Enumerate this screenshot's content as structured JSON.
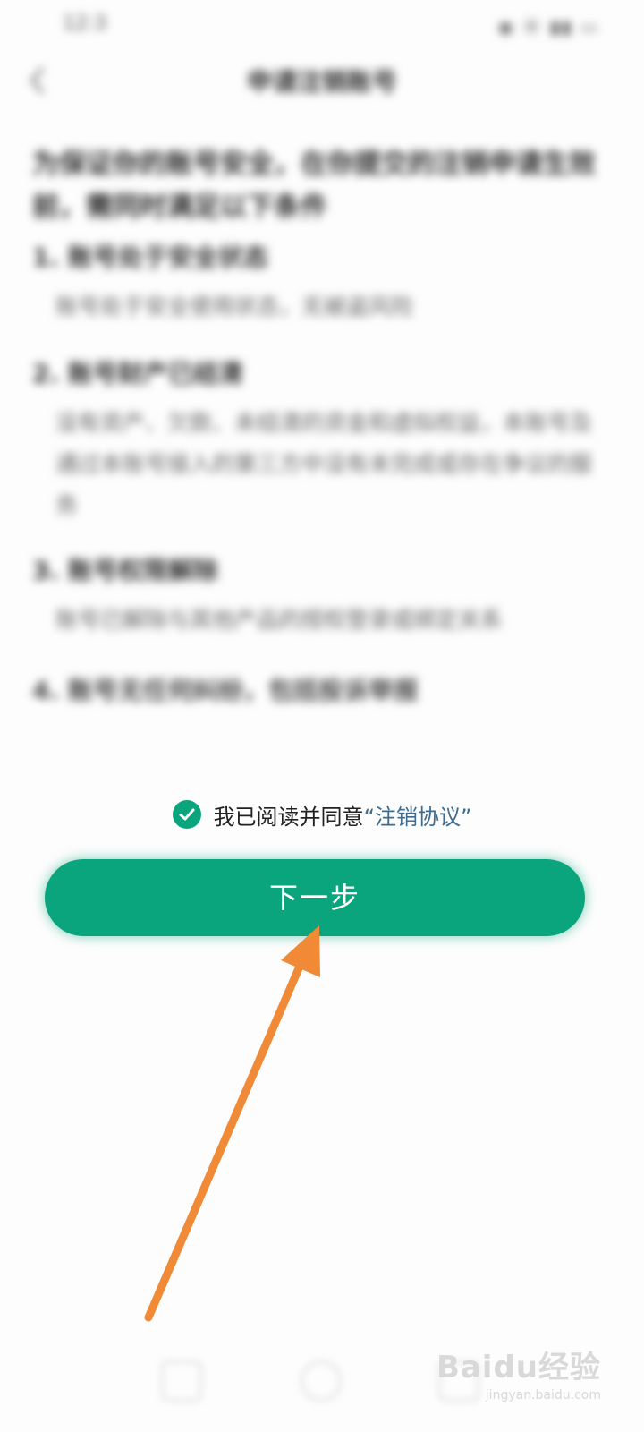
{
  "status_bar": {
    "time": "12:3",
    "icons": "◉ ⦿ ▮▮ ▭"
  },
  "nav": {
    "title": "申请注销账号"
  },
  "intro": "为保证你的账号安全，在你提交的注销申请生效前，需同时满足以下条件",
  "conditions": [
    {
      "title": "1. 账号处于安全状态",
      "desc": "账号处于安全使用状态，无被盗风险"
    },
    {
      "title": "2. 账号财产已结清",
      "desc": "没有资产、欠款、未结清的资金和虚拟权益，本账号及通过本账号接入的第三方中没有未完成或存在争议的服务"
    },
    {
      "title": "3. 账号权限解除",
      "desc": "账号已解除与其他产品的授权登录或绑定关系"
    },
    {
      "title": "4. 账号无任何纠纷，包括投诉举报",
      "desc": ""
    }
  ],
  "agreement": {
    "prefix": "我已阅读并同意",
    "link": "“注销协议”",
    "checked": true
  },
  "next_button": {
    "label": "下一步"
  },
  "watermark": {
    "logo": "Baidu经验",
    "url": "jingyan.baidu.com"
  },
  "colors": {
    "primary": "#0aa57c",
    "link": "#3f6d8f",
    "arrow": "#f08a36"
  }
}
